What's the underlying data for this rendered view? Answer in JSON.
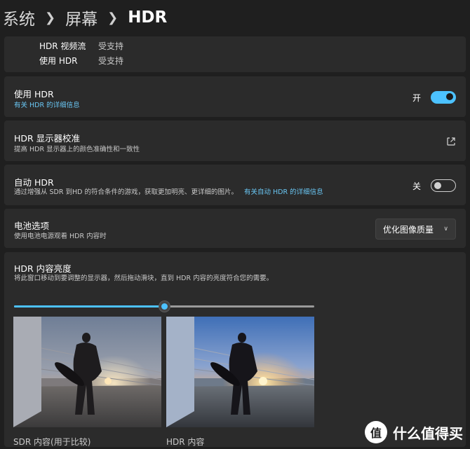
{
  "breadcrumb": {
    "items": [
      "系统",
      "屏幕"
    ],
    "current": "HDR"
  },
  "capabilities": [
    {
      "label": "HDR 视频流",
      "value": "受支持"
    },
    {
      "label": "使用 HDR",
      "value": "受支持"
    }
  ],
  "use_hdr": {
    "title": "使用 HDR",
    "link": "有关 HDR 的详细信息",
    "state_label": "开",
    "on": true
  },
  "calibration": {
    "title": "HDR 显示器校准",
    "desc": "提高 HDR 显示器上的颜色准确性和一致性",
    "icon": "external-link-icon"
  },
  "auto_hdr": {
    "title": "自动 HDR",
    "desc": "通过增强从 SDR 到HD 的符合条件的游戏，获取更加明亮、更详细的图片。",
    "link": "有关自动 HDR 的详细信息",
    "state_label": "关",
    "on": false
  },
  "battery": {
    "title": "电池选项",
    "desc": "使用电池电源观看 HDR 内容时",
    "selected": "优化图像质量"
  },
  "brightness": {
    "title": "HDR 内容亮度",
    "desc": "将此窗口移动到要调整的显示器，然后拖动滑块，直到 HDR 内容的亮度符合您的需要。",
    "level": 0.5,
    "sdr_caption": "SDR 内容(用于比较)",
    "hdr_caption": "HDR 内容"
  },
  "watermark": {
    "logo": "值",
    "text": "什么值得买"
  },
  "colors": {
    "accent": "#4cc2ff",
    "background": "#1f1f1f",
    "card": "#2b2b2b"
  }
}
